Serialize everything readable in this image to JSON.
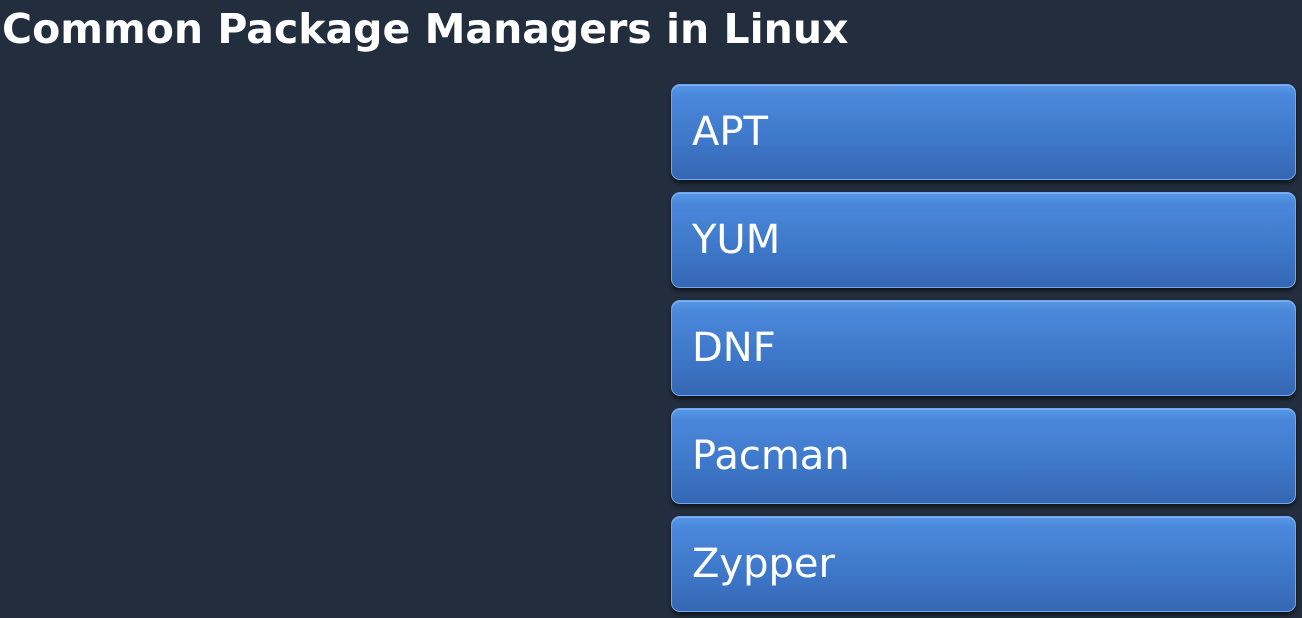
{
  "title": "Common Package Managers in Linux",
  "items": [
    {
      "label": "APT"
    },
    {
      "label": "YUM"
    },
    {
      "label": "DNF"
    },
    {
      "label": "Pacman"
    },
    {
      "label": "Zypper"
    }
  ],
  "colors": {
    "background": "#222d3d",
    "box_fill": "#3e77c9",
    "box_border": "#6fa8ef",
    "text": "#ffffff"
  }
}
